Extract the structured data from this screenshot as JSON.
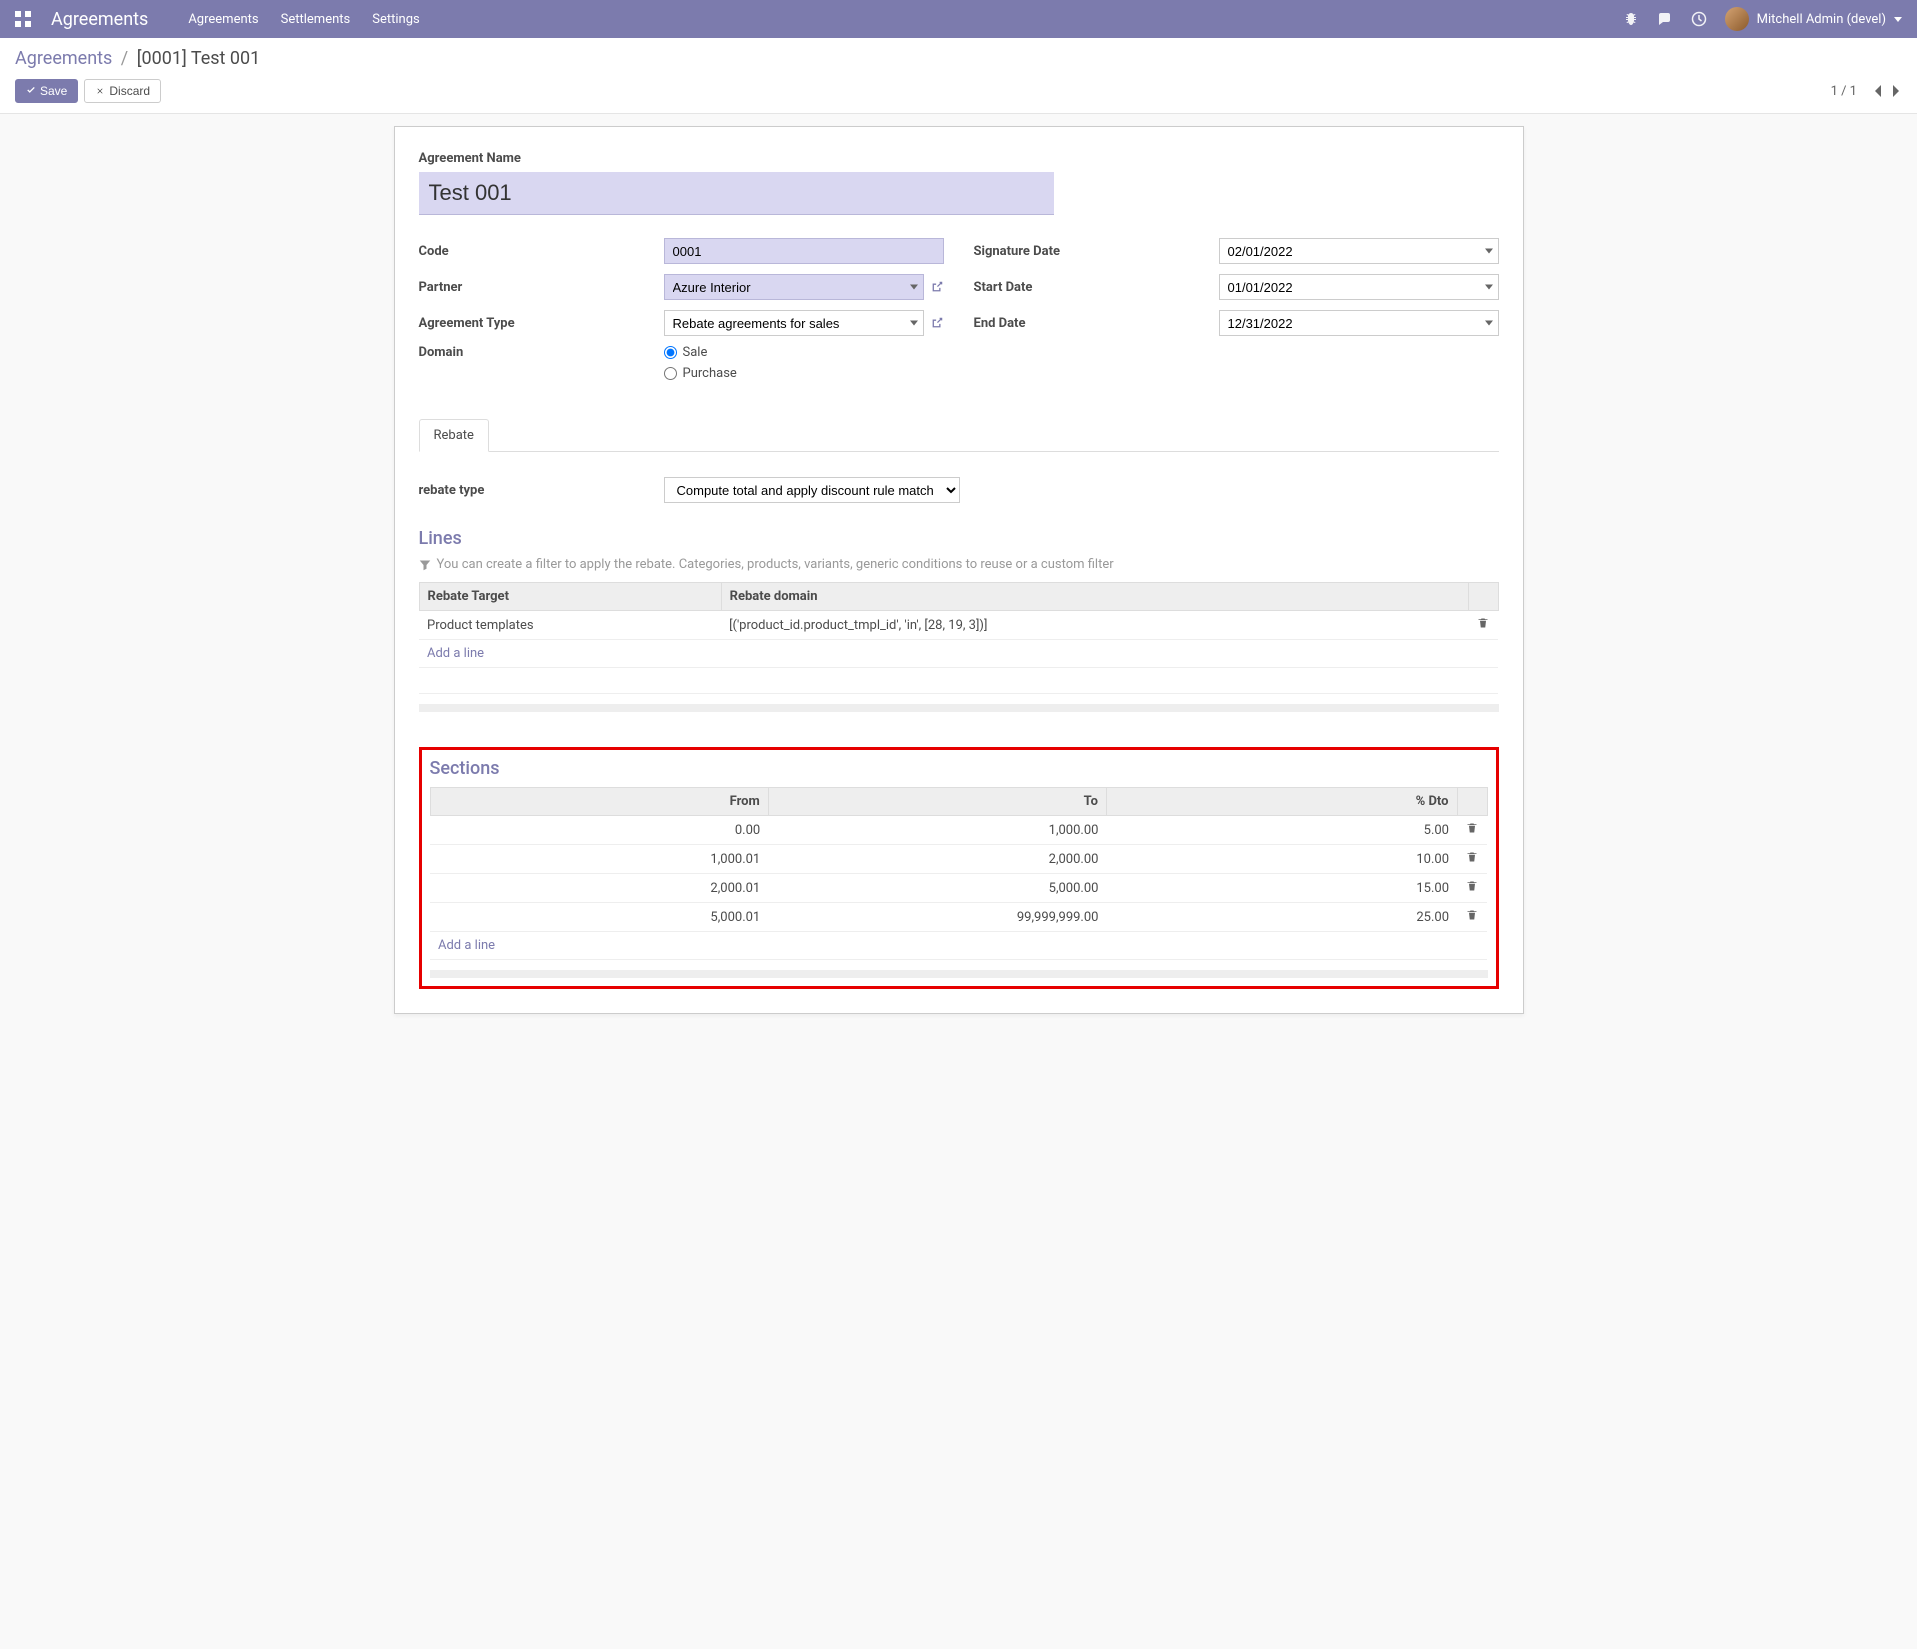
{
  "navbar": {
    "brand": "Agreements",
    "menu": [
      "Agreements",
      "Settlements",
      "Settings"
    ],
    "user": "Mitchell Admin (devel)"
  },
  "breadcrumb": {
    "parent": "Agreements",
    "current": "[0001] Test 001"
  },
  "buttons": {
    "save": "Save",
    "discard": "Discard"
  },
  "pager": {
    "text": "1 / 1"
  },
  "form": {
    "name_label": "Agreement Name",
    "name_value": "Test 001",
    "code_label": "Code",
    "code_value": "0001",
    "partner_label": "Partner",
    "partner_value": "Azure Interior",
    "type_label": "Agreement Type",
    "type_value": "Rebate agreements for sales",
    "domain_label": "Domain",
    "domain_sale": "Sale",
    "domain_purchase": "Purchase",
    "sigdate_label": "Signature Date",
    "sigdate_value": "02/01/2022",
    "start_label": "Start Date",
    "start_value": "01/01/2022",
    "end_label": "End Date",
    "end_value": "12/31/2022"
  },
  "tab": {
    "rebate": "Rebate"
  },
  "rebate": {
    "type_label": "rebate type",
    "type_value": "Compute total and apply discount rule match",
    "lines_title": "Lines",
    "hint": "You can create a filter to apply the rebate. Categories, products, variants, generic conditions to reuse or a custom filter",
    "lines_headers": {
      "target": "Rebate Target",
      "domain": "Rebate domain"
    },
    "lines": [
      {
        "target": "Product templates",
        "domain": "[('product_id.product_tmpl_id', 'in', [28, 19, 3])]"
      }
    ],
    "add_line": "Add a line",
    "sections_title": "Sections",
    "sections_headers": {
      "from": "From",
      "to": "To",
      "dto": "% Dto"
    },
    "sections": [
      {
        "from": "0.00",
        "to": "1,000.00",
        "dto": "5.00"
      },
      {
        "from": "1,000.01",
        "to": "2,000.00",
        "dto": "10.00"
      },
      {
        "from": "2,000.01",
        "to": "5,000.00",
        "dto": "15.00"
      },
      {
        "from": "5,000.01",
        "to": "99,999,999.00",
        "dto": "25.00"
      }
    ]
  }
}
